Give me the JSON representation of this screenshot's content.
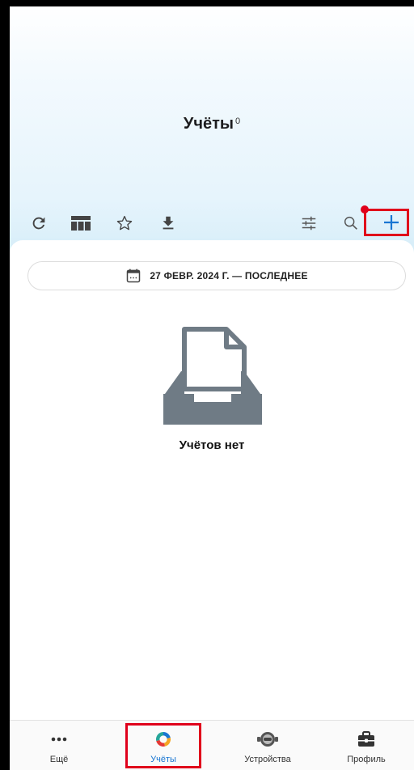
{
  "header": {
    "title": "Учёты",
    "count": "0"
  },
  "toolbar": {
    "icons": [
      "refresh-icon",
      "table-icon",
      "star-icon",
      "download-icon",
      "filter-sliders-icon",
      "search-icon",
      "plus-icon"
    ],
    "accent": "#1976d2",
    "notification_dot_color": "#e0001b"
  },
  "date_filter": {
    "label": "27 ФЕВР. 2024 Г. — ПОСЛЕДНЕЕ",
    "icon": "calendar-icon"
  },
  "empty_state": {
    "icon": "empty-inbox-icon",
    "message": "Учётов нет"
  },
  "bottom_nav": {
    "items": [
      {
        "label": "Ещё",
        "icon": "more-icon"
      },
      {
        "label": "Учёты",
        "icon": "records-logo-icon",
        "active": true
      },
      {
        "label": "Устройства",
        "icon": "device-icon"
      },
      {
        "label": "Профиль",
        "icon": "briefcase-icon"
      }
    ]
  },
  "highlight_color": "#e0001b"
}
